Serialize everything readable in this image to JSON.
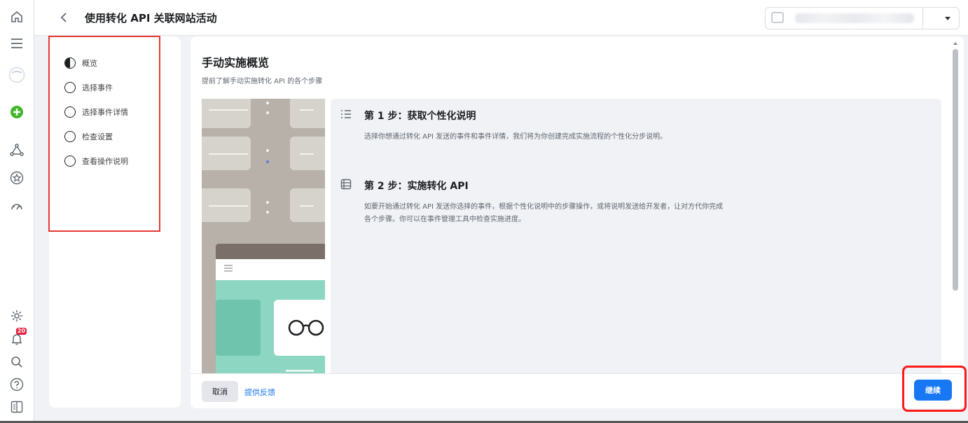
{
  "header": {
    "title": "使用转化 API 关联网站活动"
  },
  "sidebar": {
    "steps": [
      {
        "label": "概览",
        "state": "in-progress"
      },
      {
        "label": "选择事件",
        "state": "not-started"
      },
      {
        "label": "选择事件详情",
        "state": "not-started"
      },
      {
        "label": "检查设置",
        "state": "not-started"
      },
      {
        "label": "查看操作说明",
        "state": "not-started"
      }
    ]
  },
  "main": {
    "title": "手动实施概览",
    "subtitle": "提前了解手动实施转化 API 的各个步骤",
    "steps": [
      {
        "heading": "第 1 步：获取个性化说明",
        "text": "选择你想通过转化 API 发送的事件和事件详情，我们将为你创建完成实施流程的个性化分步说明。"
      },
      {
        "heading": "第 2 步：实施转化 API",
        "text": "如要开始通过转化 API 发送你选择的事件，根据个性化说明中的步骤操作，或将说明发送给开发者，让对方代你完成各个步骤。你可以在事件管理工具中检查实施进度。"
      }
    ]
  },
  "footer": {
    "cancel_label": "取消",
    "feedback_label": "提供反馈",
    "continue_label": "继续"
  },
  "rail": {
    "notification_badge": "20"
  },
  "colors": {
    "accent": "#1877f2",
    "highlight": "#e53935",
    "create_button": "#42b72a"
  }
}
